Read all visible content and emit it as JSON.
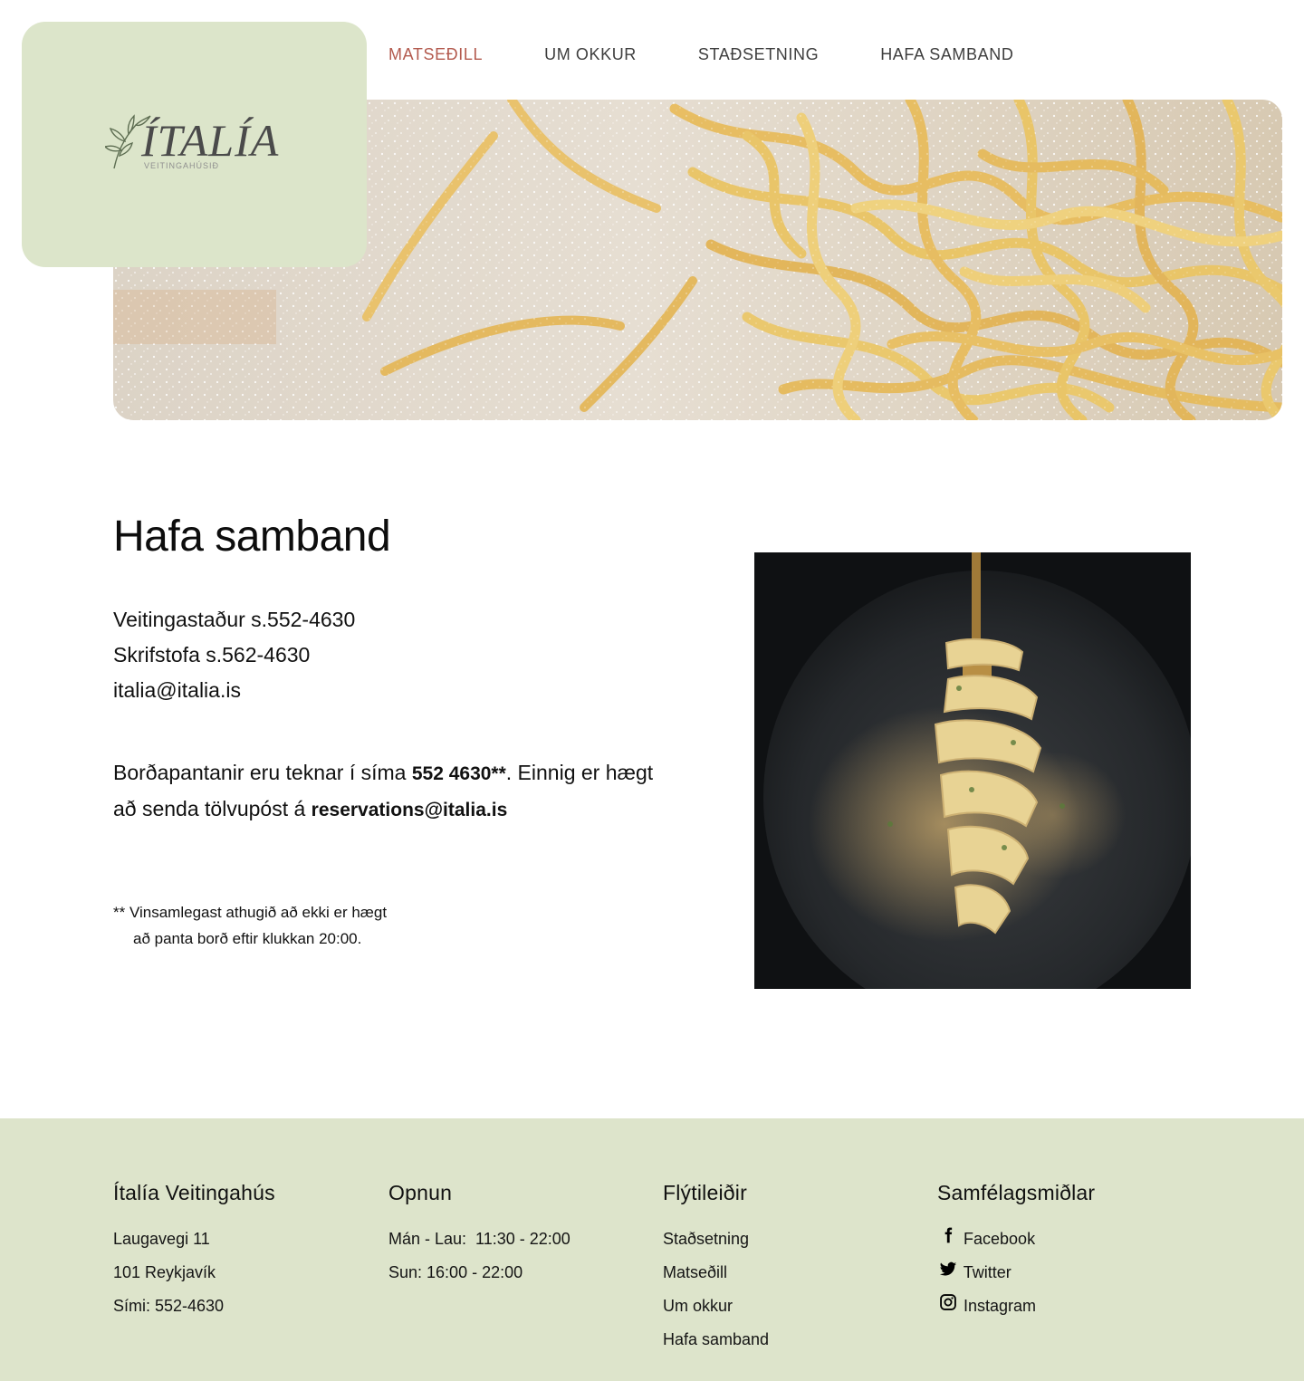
{
  "logo": {
    "name": "ÍTALÍA",
    "tagline": "VEITINGAHÚSIÐ"
  },
  "nav": {
    "items": [
      {
        "label": "MATSEÐILL",
        "active": true
      },
      {
        "label": "UM OKKUR",
        "active": false
      },
      {
        "label": "STAÐSETNING",
        "active": false
      },
      {
        "label": "HAFA SAMBAND",
        "active": false
      }
    ]
  },
  "main": {
    "title": "Hafa samband",
    "contact": {
      "restaurant_phone": "Veitingastaður s.552-4630",
      "office_phone": "Skrifstofa s.562-4630",
      "email": "italia@italia.is"
    },
    "reservation": {
      "text_before": "Borðapantanir eru teknar í síma ",
      "phone_bold": "552 4630**",
      "text_middle": ". Einnig er hægt að senda tölvupóst á ",
      "email_bold": "reservations@italia.is"
    },
    "footnote": {
      "line1": "** Vinsamlegast athugið að ekki er hægt",
      "line2": "að panta borð eftir klukkan 20:00."
    }
  },
  "footer": {
    "about": {
      "heading": "Ítalía Veitingahús",
      "lines": [
        "Laugavegi 11",
        "101 Reykjavík",
        "Sími: 552-4630"
      ]
    },
    "hours": {
      "heading": "Opnun",
      "lines": [
        "Mán - Lau:  11:30 - 22:00",
        "Sun: 16:00 - 22:00"
      ]
    },
    "links": {
      "heading": "Flýtileiðir",
      "items": [
        "Staðsetning",
        "Matseðill",
        "Um okkur",
        "Hafa samband"
      ]
    },
    "social": {
      "heading": "Samfélagsmiðlar",
      "items": [
        {
          "label": "Facebook",
          "icon": "facebook-icon"
        },
        {
          "label": "Twitter",
          "icon": "twitter-icon"
        },
        {
          "label": "Instagram",
          "icon": "instagram-icon"
        }
      ]
    }
  },
  "colors": {
    "brand_green": "#dce5ca",
    "nav_active": "#b35a4e",
    "nav_text": "#3e3e3e",
    "text": "#111111"
  }
}
